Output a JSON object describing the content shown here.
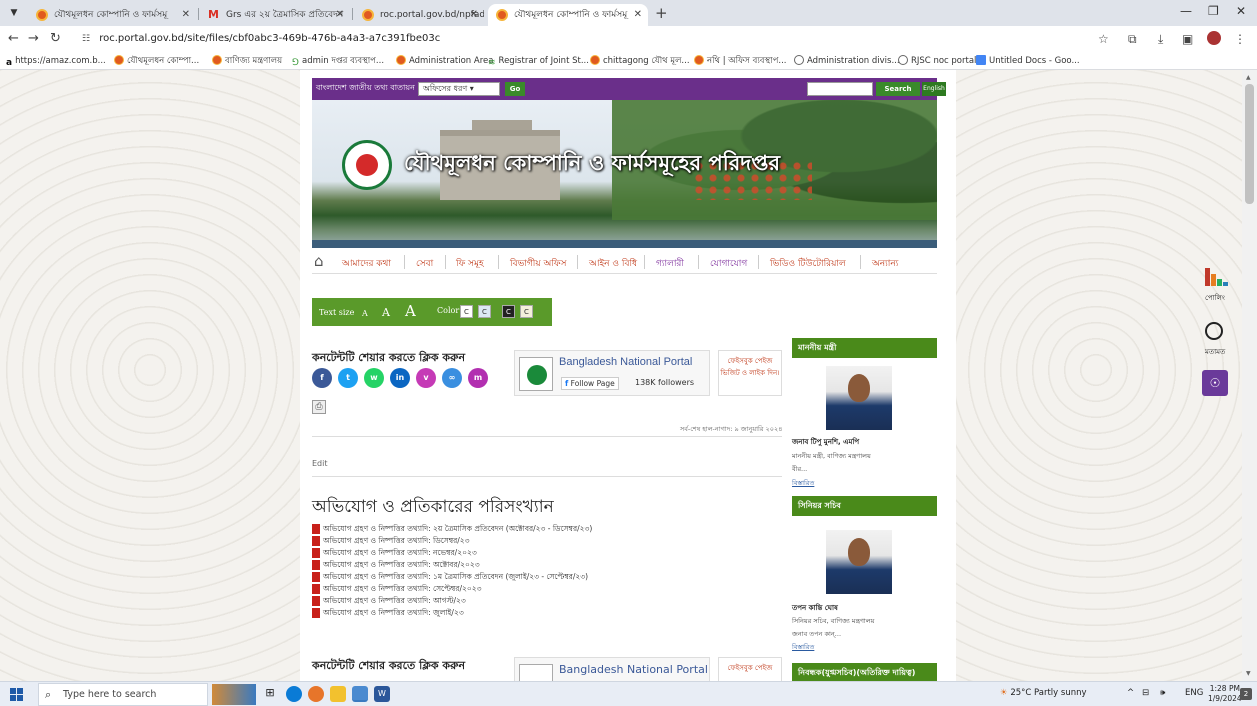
{
  "browser": {
    "tabs": [
      {
        "label": "যৌথমূলধন কোম্পানি ও ফার্মসমূ"
      },
      {
        "label": "Grs এর ২য় ত্রৈমাসিক প্রতিবেদন"
      },
      {
        "label": "roc.portal.gov.bd/npfadmin/pu"
      },
      {
        "label": "যৌথমূলধন কোম্পানি ও ফার্মসমূ"
      }
    ],
    "url": "roc.portal.gov.bd/site/files/cbf0abc3-469b-476b-a4a3-a7c391fbe03c",
    "bookmarks": [
      "https://amaz.com.b...",
      "যৌথমূলধন কোম্পা...",
      "বাণিজ্য মন্ত্রণালয়",
      "admin দপ্তর ব্যবস্থাপ...",
      "Administration Area",
      "Registrar of Joint St...",
      "chittagong যৌথ মূল...",
      "নথি | অফিস ব্যবস্থাপ...",
      "Administration divis...",
      "RJSC noc portal",
      "Untitled Docs - Goo..."
    ]
  },
  "topstrip": {
    "portal_label": "বাংলাদেশ জাতীয় তথ্য বাতায়ন",
    "office_type": "অফিসের ধরণ",
    "go": "Go",
    "search": "Search",
    "english": "English"
  },
  "banner": {
    "title": "যৌথমূলধন কোম্পানি ও ফার্মসমূহের পরিদপ্তর"
  },
  "nav": [
    "আমাদের কথা",
    "সেবা",
    "ফি সমূহ",
    "বিভাগীয় অফিস",
    "আইন ও বিধি",
    "গ্যালারী",
    "যোগাযোগ",
    "ভিডিও টিউটোরিয়াল",
    "অন্যান্য"
  ],
  "textsize": {
    "label": "Text size",
    "a_small": "A",
    "a_mid": "A",
    "a_large": "A",
    "color_label": "Color",
    "swatches": [
      "C",
      "C",
      "C",
      "C"
    ]
  },
  "main": {
    "share_title": "কনটেন্টটি শেয়ার করতে ক্লিক করুন",
    "portal_name": "Bangladesh National Portal",
    "follow_page": "Follow Page",
    "followers": "138K followers",
    "fb_like_text": "ফেইসবুক পেইজ ভিজিট ও লাইক দিন।",
    "last_update": "সর্ব-শেষ হাল-নাগাদ: ৯ জানুয়ারি ২০২৪",
    "edit": "Edit",
    "page_title": "অভিযোগ ও প্রতিকারের পরিসংখ্যান",
    "documents": [
      "অভিযোগ গ্রহণ ও নিষ্পত্তির তথ্যাদি: ২য় ত্রৈমাসিক প্রতিবেদন (অক্টোবর/২৩ - ডিসেম্বর/২৩)",
      "অভিযোগ গ্রহণ ও নিষ্পত্তির তথ্যাদি: ডিসেম্বর/২৩",
      "অভিযোগ গ্রহণ ও নিষ্পত্তির তথ্যাদি: নভেম্বর/২০২৩",
      "অভিযোগ গ্রহণ ও নিষ্পত্তির তথ্যাদি: অক্টোবর/২০২৩",
      "অভিযোগ গ্রহণ ও নিষ্পত্তির তথ্যাদি: ১ম ত্রৈমাসিক প্রতিবেদন (জুলাই/২৩ - সেপ্টেম্বর/২৩)",
      "অভিযোগ গ্রহণ ও নিষ্পত্তির তথ্যাদি: সেপ্টেম্বর/২০২৩",
      "অভিযোগ গ্রহণ ও নিষ্পত্তির তথ্যাদি: আগস্ট/২৩",
      "অভিযোগ গ্রহণ ও নিষ্পত্তির তথ্যাদি: জুলাই/২৩"
    ],
    "fb_like_short": "ফেইসবুক পেইজ"
  },
  "sidebar": {
    "minister_head": "মাননীয় মন্ত্রী",
    "minister_name": "জনাব টিপু মুনশি, এমপি",
    "minister_post": "মাননীয় মন্ত্রী, বাণিজ্য মন্ত্রণালয়",
    "minister_bio": "বীর...",
    "more": "বিস্তারিত",
    "secretary_head": "সিনিয়র সচিব",
    "secretary_name": "তপন কান্তি ঘোষ",
    "secretary_post": "সিনিয়র সচিব, বাণিজ্য মন্ত্রণালয়",
    "secretary_bio": "জনাব তপন কান্...",
    "third_head": "নিবন্ধক(যুগ্মসচিব)(অতিরিক্ত দায়িত্ব)"
  },
  "widgets": {
    "poll": "পোলিং",
    "feedback": "মতামত"
  },
  "taskbar": {
    "search_placeholder": "Type here to search",
    "weather": "25°C  Partly sunny",
    "lang": "ENG",
    "time": "1:28 PM",
    "date": "1/9/2024",
    "notifications": "2"
  }
}
